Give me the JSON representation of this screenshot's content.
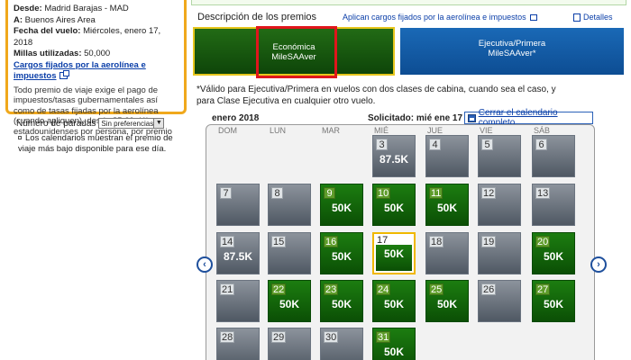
{
  "summary": {
    "from_label": "Desde:",
    "from_value": "Madrid Barajas - MAD",
    "to_label": "A:",
    "to_value": "Buenos Aires Area",
    "date_label": "Fecha del vuelo:",
    "date_value": "Miércoles, enero 17, 2018",
    "miles_label": "Millas utilizadas:",
    "miles_value": "50,000",
    "fees_link": "Cargos fijados por la aerolínea e impuestos",
    "description": "Todo premio de viaje exige el pago de impuestos/tasas gubernamentales así como de tasas fijadas por la aerolínea (cuando apliquen), desde $5.60 dólares estadounidenses por persona, por premio"
  },
  "stops": {
    "label": "Número de paradas",
    "selected": "Sin preferencias"
  },
  "note": "Los calendarios muestran el premio de viaje más bajo disponible para ese día.",
  "prizes": {
    "title": "Descripción de los premios",
    "apply_link": "Aplican cargos fijados por la aerolínea e impuestos",
    "details_link": "Detalles",
    "tabs": [
      {
        "line1": "Económica",
        "line2": "MileSAAver"
      },
      {
        "line1": "Ejecutiva/Primera",
        "line2": "MileSAAver*"
      }
    ],
    "valid_note": "*Válido para Ejecutiva/Primera en vuelos con dos clases de cabina, cuando sea el caso, y para Clase Ejecutiva en cualquier otro vuelo."
  },
  "calendar": {
    "month": "enero 2018",
    "requested_label": "Solicitado:",
    "requested_value": "mié ene 17",
    "close_link": "Cerrar el calendario completo",
    "prev_icon": "‹",
    "next_icon": "›",
    "weekdays": [
      "DOM",
      "LUN",
      "MAR",
      "MIÉ",
      "JUE",
      "VIE",
      "SÁB"
    ],
    "days": [
      {
        "day": "3",
        "value": "87.5K",
        "status": "gray"
      },
      {
        "day": "4",
        "value": "",
        "status": "gray"
      },
      {
        "day": "5",
        "value": "",
        "status": "gray"
      },
      {
        "day": "6",
        "value": "",
        "status": "gray"
      },
      {
        "day": "7",
        "value": "",
        "status": "gray"
      },
      {
        "day": "8",
        "value": "",
        "status": "gray"
      },
      {
        "day": "9",
        "value": "50K",
        "status": "green"
      },
      {
        "day": "10",
        "value": "50K",
        "status": "green"
      },
      {
        "day": "11",
        "value": "50K",
        "status": "green"
      },
      {
        "day": "12",
        "value": "",
        "status": "gray"
      },
      {
        "day": "13",
        "value": "",
        "status": "gray"
      },
      {
        "day": "14",
        "value": "87.5K",
        "status": "gray"
      },
      {
        "day": "15",
        "value": "",
        "status": "gray"
      },
      {
        "day": "16",
        "value": "50K",
        "status": "green"
      },
      {
        "day": "17",
        "value": "50K",
        "status": "selected"
      },
      {
        "day": "18",
        "value": "",
        "status": "gray"
      },
      {
        "day": "19",
        "value": "",
        "status": "gray"
      },
      {
        "day": "20",
        "value": "50K",
        "status": "green"
      },
      {
        "day": "21",
        "value": "",
        "status": "gray"
      },
      {
        "day": "22",
        "value": "50K",
        "status": "green"
      },
      {
        "day": "23",
        "value": "50K",
        "status": "green"
      },
      {
        "day": "24",
        "value": "50K",
        "status": "green"
      },
      {
        "day": "25",
        "value": "50K",
        "status": "green"
      },
      {
        "day": "26",
        "value": "",
        "status": "gray"
      },
      {
        "day": "27",
        "value": "50K",
        "status": "green"
      },
      {
        "day": "28",
        "value": "",
        "status": "gray"
      },
      {
        "day": "29",
        "value": "",
        "status": "gray"
      },
      {
        "day": "30",
        "value": "",
        "status": "gray"
      },
      {
        "day": "31",
        "value": "50K",
        "status": "green"
      }
    ]
  },
  "colors": {
    "accent_orange": "#f0a81c",
    "econ_green": "#0e4509",
    "exec_blue": "#0d4d93",
    "highlight_red": "#e0161c",
    "link_blue": "#0a3ea8"
  }
}
